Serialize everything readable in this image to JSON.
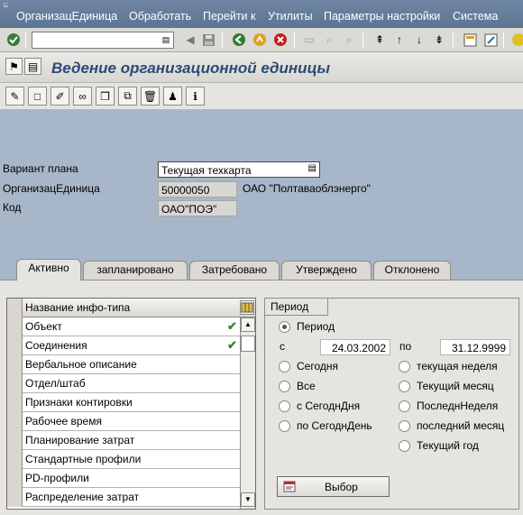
{
  "menu": [
    "ОрганизацЕдиница",
    "Обработать",
    "Перейти к",
    "Утилиты",
    "Параметры настройки",
    "Система"
  ],
  "command_field": "",
  "title": "Ведение организационной единицы",
  "fields": {
    "plan_variant_label": "Вариант плана",
    "plan_variant_value": "Текущая техкарта",
    "org_unit_label": "ОрганизацЕдиница",
    "org_unit_value": "50000050",
    "org_unit_name": "ОАО \"Полтаваоблэнерго\"",
    "code_label": "Код",
    "code_value": "ОАО\"ПОЭ\""
  },
  "tabs": [
    "Активно",
    "запланировано",
    "Затребовано",
    "Утверждено",
    "Отклонено"
  ],
  "active_tab": "Активно",
  "infotype_table": {
    "header": "Название инфо-типа",
    "rows": [
      {
        "label": "Объект",
        "checked": true
      },
      {
        "label": "Соединения",
        "checked": true
      },
      {
        "label": "Вербальное описание",
        "checked": false
      },
      {
        "label": "Отдел/штаб",
        "checked": false
      },
      {
        "label": "Признаки контировки",
        "checked": false
      },
      {
        "label": "Рабочее время",
        "checked": false
      },
      {
        "label": "Планирование затрат",
        "checked": false
      },
      {
        "label": "Стандартные профили",
        "checked": false
      },
      {
        "label": "PD-профили",
        "checked": false
      },
      {
        "label": "Распределение затрат",
        "checked": false
      }
    ]
  },
  "period": {
    "title": "Период",
    "period_option": "Период",
    "from_label": "с",
    "from_date": "24.03.2002",
    "to_label": "по",
    "to_date": "31.12.9999",
    "left_options": [
      "Сегодня",
      "Все",
      "с СегоднДня",
      "по СегоднДень"
    ],
    "right_options": [
      "текущая неделя",
      "Текущий месяц",
      "ПоследнНеделя",
      "последний месяц",
      "Текущий год"
    ],
    "selected": "Период",
    "button": "Выбор"
  },
  "colors": {
    "menubar": "#6f86a3",
    "title_text": "#2b4a78",
    "work_area": "#a7b6c8",
    "check": "#2f8a2f"
  }
}
